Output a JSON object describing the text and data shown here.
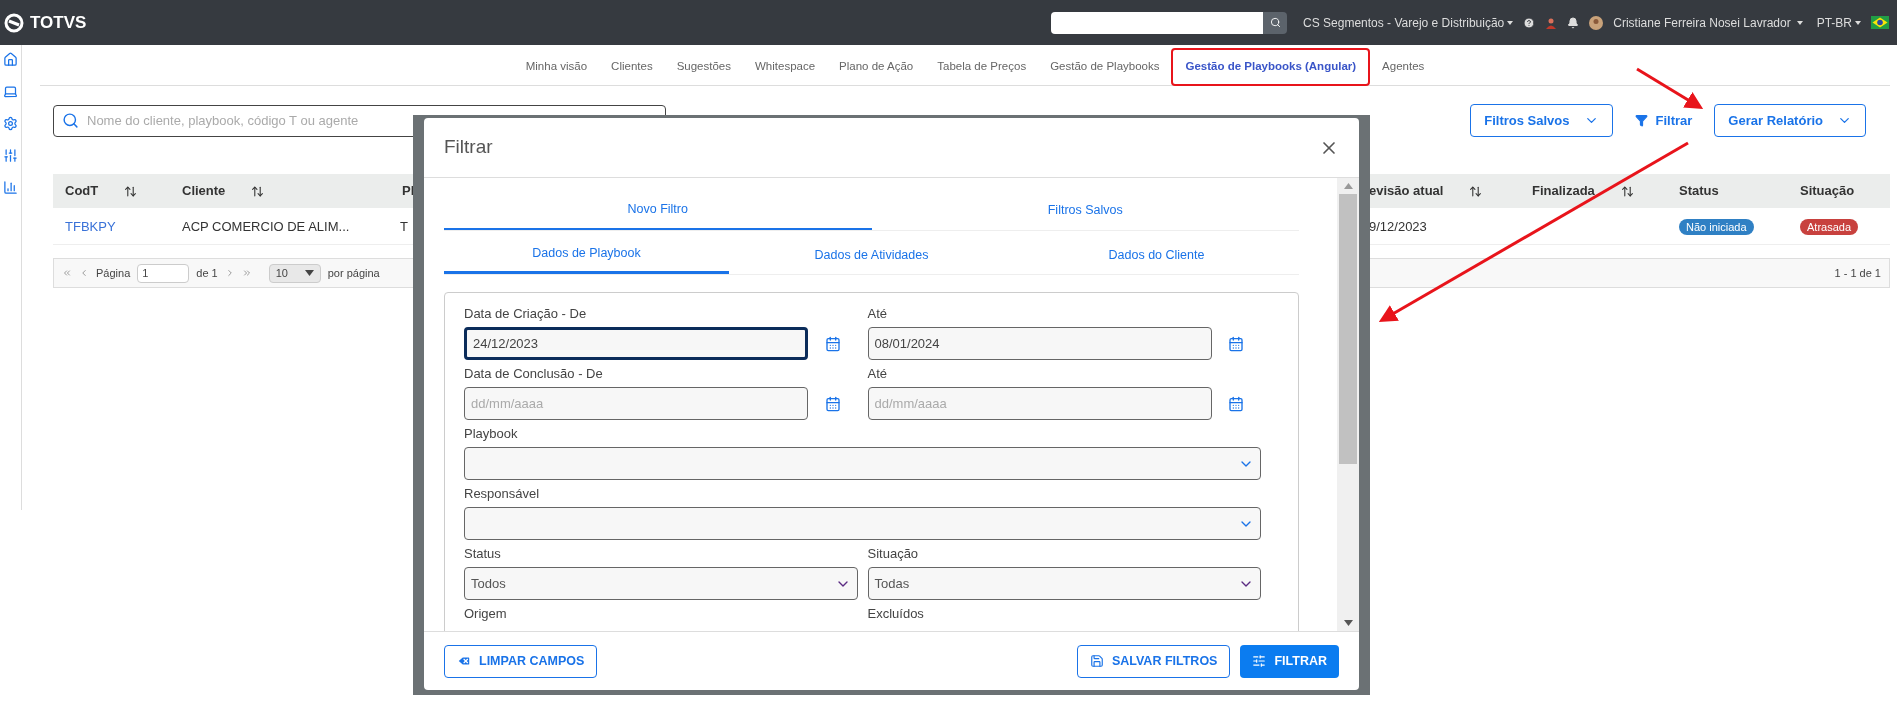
{
  "topbar": {
    "logo": "TOTVS",
    "segment": "CS Segmentos - Varejo e Distribuição",
    "user": "Cristiane Ferreira Nosei Lavrador",
    "language": "PT-BR"
  },
  "nav_tabs": [
    {
      "label": "Minha visão",
      "selected": false
    },
    {
      "label": "Clientes",
      "selected": false
    },
    {
      "label": "Sugestões",
      "selected": false
    },
    {
      "label": "Whitespace",
      "selected": false
    },
    {
      "label": "Plano de Ação",
      "selected": false
    },
    {
      "label": "Tabela de Preços",
      "selected": false
    },
    {
      "label": "Gestão de Playbooks",
      "selected": false
    },
    {
      "label": "Gestão de Playbooks (Angular)",
      "selected": true
    },
    {
      "label": "Agentes",
      "selected": false
    }
  ],
  "search": {
    "placeholder": "Nome do cliente, playbook, código T ou agente"
  },
  "actions": [
    {
      "label": "Filtros Salvos",
      "kind": "dropdown"
    },
    {
      "label": "Filtrar",
      "kind": "link"
    },
    {
      "label": "Gerar Relatório",
      "kind": "dropdown"
    }
  ],
  "table": {
    "columns": [
      {
        "label": "CodT",
        "sortable": true
      },
      {
        "label": "Cliente",
        "sortable": true
      },
      {
        "label": "Pl",
        "sortable": false
      },
      {
        "label": "evisão atual",
        "sortable": true
      },
      {
        "label": "Finalizada",
        "sortable": true
      },
      {
        "label": "Status",
        "sortable": false
      },
      {
        "label": "Situação",
        "sortable": false
      }
    ],
    "rows": [
      {
        "codt": "TFBKPY",
        "cliente": "ACP COMERCIO DE ALIM...",
        "column_3": "T",
        "column_4": "9/12/2023",
        "status": {
          "label": "Não iniciada",
          "color": "#2f80c4"
        },
        "situacao": {
          "label": "Atrasada",
          "color": "#c8413e"
        }
      }
    ]
  },
  "pagination": {
    "page_label": "Página",
    "page": "1",
    "of": "de 1",
    "page_size": "10",
    "per_page": "por página",
    "range": "1 - 1 de 1"
  },
  "modal": {
    "title": "Filtrar",
    "tabs": [
      {
        "label": "Novo Filtro",
        "selected": true
      },
      {
        "label": "Filtros Salvos",
        "selected": false
      }
    ],
    "subtabs": [
      {
        "label": "Dados de Playbook",
        "selected": true
      },
      {
        "label": "Dados de Atividades",
        "selected": false
      },
      {
        "label": "Dados do Cliente",
        "selected": false
      }
    ],
    "rows": [
      [
        {
          "label": "Data de Criação - De",
          "kind": "date",
          "value": "24/12/2023",
          "focused": true
        },
        {
          "label": "Até",
          "kind": "date",
          "value": "08/01/2024",
          "focused": false
        }
      ],
      [
        {
          "label": "Data de Conclusão - De",
          "kind": "date",
          "placeholder": "dd/mm/aaaa",
          "focused": false
        },
        {
          "label": "Até",
          "kind": "date",
          "placeholder": "dd/mm/aaaa",
          "focused": false
        }
      ],
      [
        {
          "label": "Playbook",
          "kind": "combo"
        }
      ],
      [
        {
          "label": "Responsável",
          "kind": "combo"
        }
      ],
      [
        {
          "label": "Status",
          "kind": "select",
          "value": "Todos"
        },
        {
          "label": "Situação",
          "kind": "select",
          "value": "Todas"
        }
      ],
      [
        {
          "label": "Origem",
          "kind": "cut"
        },
        {
          "label": "Excluídos",
          "kind": "cut"
        }
      ]
    ],
    "buttons": [
      {
        "label": "LIMPAR CAMPOS",
        "kind": "clear"
      },
      {
        "label": "SALVAR FILTROS",
        "kind": "save"
      },
      {
        "label": "FILTRAR",
        "kind": "apply"
      }
    ]
  }
}
